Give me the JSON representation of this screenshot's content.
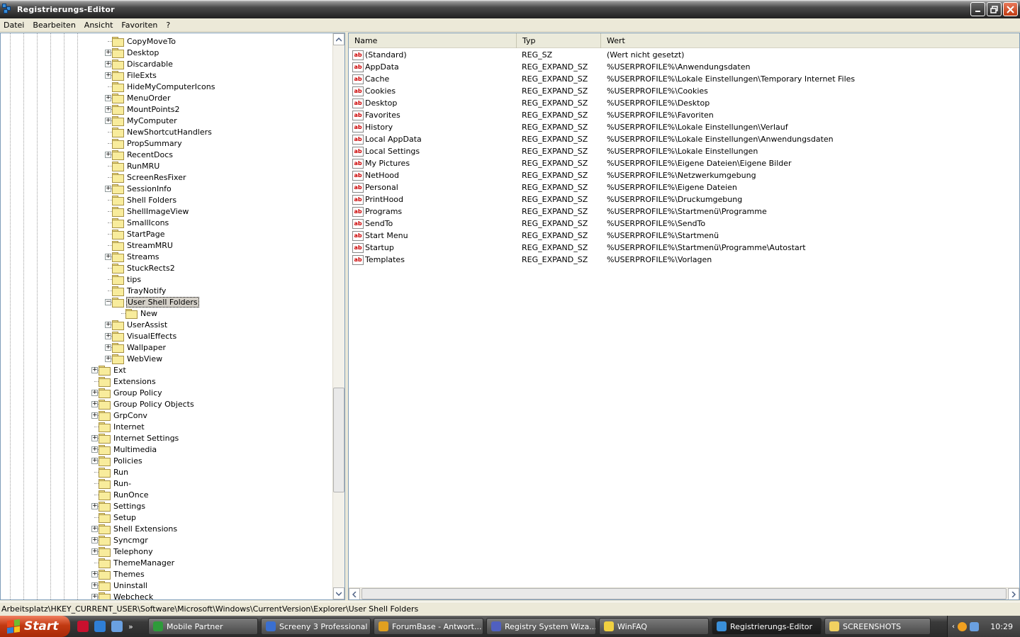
{
  "window": {
    "title": "Registrierungs-Editor"
  },
  "menu": [
    "Datei",
    "Bearbeiten",
    "Ansicht",
    "Favoriten",
    "?"
  ],
  "tree": {
    "items": [
      {
        "label": "CopyMoveTo",
        "level": 1,
        "expand": false
      },
      {
        "label": "Desktop",
        "level": 1,
        "expand": true
      },
      {
        "label": "Discardable",
        "level": 1,
        "expand": true
      },
      {
        "label": "FileExts",
        "level": 1,
        "expand": true
      },
      {
        "label": "HideMyComputerIcons",
        "level": 1,
        "expand": false
      },
      {
        "label": "MenuOrder",
        "level": 1,
        "expand": true
      },
      {
        "label": "MountPoints2",
        "level": 1,
        "expand": true
      },
      {
        "label": "MyComputer",
        "level": 1,
        "expand": true
      },
      {
        "label": "NewShortcutHandlers",
        "level": 1,
        "expand": false
      },
      {
        "label": "PropSummary",
        "level": 1,
        "expand": false
      },
      {
        "label": "RecentDocs",
        "level": 1,
        "expand": true
      },
      {
        "label": "RunMRU",
        "level": 1,
        "expand": false
      },
      {
        "label": "ScreenResFixer",
        "level": 1,
        "expand": false
      },
      {
        "label": "SessionInfo",
        "level": 1,
        "expand": true
      },
      {
        "label": "Shell Folders",
        "level": 1,
        "expand": false
      },
      {
        "label": "ShellImageView",
        "level": 1,
        "expand": false
      },
      {
        "label": "SmallIcons",
        "level": 1,
        "expand": false
      },
      {
        "label": "StartPage",
        "level": 1,
        "expand": false
      },
      {
        "label": "StreamMRU",
        "level": 1,
        "expand": false
      },
      {
        "label": "Streams",
        "level": 1,
        "expand": true
      },
      {
        "label": "StuckRects2",
        "level": 1,
        "expand": false
      },
      {
        "label": "tips",
        "level": 1,
        "expand": false
      },
      {
        "label": "TrayNotify",
        "level": 1,
        "expand": false
      },
      {
        "label": "User Shell Folders",
        "level": 1,
        "expand": "minus",
        "selected": true
      },
      {
        "label": "New",
        "level": 2,
        "expand": false
      },
      {
        "label": "UserAssist",
        "level": 1,
        "expand": true
      },
      {
        "label": "VisualEffects",
        "level": 1,
        "expand": true
      },
      {
        "label": "Wallpaper",
        "level": 1,
        "expand": true
      },
      {
        "label": "WebView",
        "level": 1,
        "expand": true
      },
      {
        "label": "Ext",
        "level": 0,
        "expand": true
      },
      {
        "label": "Extensions",
        "level": 0,
        "expand": false
      },
      {
        "label": "Group Policy",
        "level": 0,
        "expand": true
      },
      {
        "label": "Group Policy Objects",
        "level": 0,
        "expand": true
      },
      {
        "label": "GrpConv",
        "level": 0,
        "expand": true
      },
      {
        "label": "Internet",
        "level": 0,
        "expand": false
      },
      {
        "label": "Internet Settings",
        "level": 0,
        "expand": true
      },
      {
        "label": "Multimedia",
        "level": 0,
        "expand": true
      },
      {
        "label": "Policies",
        "level": 0,
        "expand": true
      },
      {
        "label": "Run",
        "level": 0,
        "expand": false
      },
      {
        "label": "Run-",
        "level": 0,
        "expand": false
      },
      {
        "label": "RunOnce",
        "level": 0,
        "expand": false
      },
      {
        "label": "Settings",
        "level": 0,
        "expand": true
      },
      {
        "label": "Setup",
        "level": 0,
        "expand": false
      },
      {
        "label": "Shell Extensions",
        "level": 0,
        "expand": true
      },
      {
        "label": "Syncmgr",
        "level": 0,
        "expand": true
      },
      {
        "label": "Telephony",
        "level": 0,
        "expand": true
      },
      {
        "label": "ThemeManager",
        "level": 0,
        "expand": false
      },
      {
        "label": "Themes",
        "level": 0,
        "expand": true
      },
      {
        "label": "Uninstall",
        "level": 0,
        "expand": true
      },
      {
        "label": "Webcheck",
        "level": 0,
        "expand": true
      }
    ]
  },
  "list": {
    "columns": [
      "Name",
      "Typ",
      "Wert"
    ],
    "rows": [
      {
        "name": "(Standard)",
        "type": "REG_SZ",
        "value": "(Wert nicht gesetzt)"
      },
      {
        "name": "AppData",
        "type": "REG_EXPAND_SZ",
        "value": "%USERPROFILE%\\Anwendungsdaten"
      },
      {
        "name": "Cache",
        "type": "REG_EXPAND_SZ",
        "value": "%USERPROFILE%\\Lokale Einstellungen\\Temporary Internet Files"
      },
      {
        "name": "Cookies",
        "type": "REG_EXPAND_SZ",
        "value": "%USERPROFILE%\\Cookies"
      },
      {
        "name": "Desktop",
        "type": "REG_EXPAND_SZ",
        "value": "%USERPROFILE%\\Desktop"
      },
      {
        "name": "Favorites",
        "type": "REG_EXPAND_SZ",
        "value": "%USERPROFILE%\\Favoriten"
      },
      {
        "name": "History",
        "type": "REG_EXPAND_SZ",
        "value": "%USERPROFILE%\\Lokale Einstellungen\\Verlauf"
      },
      {
        "name": "Local AppData",
        "type": "REG_EXPAND_SZ",
        "value": "%USERPROFILE%\\Lokale Einstellungen\\Anwendungsdaten"
      },
      {
        "name": "Local Settings",
        "type": "REG_EXPAND_SZ",
        "value": "%USERPROFILE%\\Lokale Einstellungen"
      },
      {
        "name": "My Pictures",
        "type": "REG_EXPAND_SZ",
        "value": "%USERPROFILE%\\Eigene Dateien\\Eigene Bilder"
      },
      {
        "name": "NetHood",
        "type": "REG_EXPAND_SZ",
        "value": "%USERPROFILE%\\Netzwerkumgebung"
      },
      {
        "name": "Personal",
        "type": "REG_EXPAND_SZ",
        "value": "%USERPROFILE%\\Eigene Dateien"
      },
      {
        "name": "PrintHood",
        "type": "REG_EXPAND_SZ",
        "value": "%USERPROFILE%\\Druckumgebung"
      },
      {
        "name": "Programs",
        "type": "REG_EXPAND_SZ",
        "value": "%USERPROFILE%\\Startmenü\\Programme"
      },
      {
        "name": "SendTo",
        "type": "REG_EXPAND_SZ",
        "value": "%USERPROFILE%\\SendTo"
      },
      {
        "name": "Start Menu",
        "type": "REG_EXPAND_SZ",
        "value": "%USERPROFILE%\\Startmenü"
      },
      {
        "name": "Startup",
        "type": "REG_EXPAND_SZ",
        "value": "%USERPROFILE%\\Startmenü\\Programme\\Autostart"
      },
      {
        "name": "Templates",
        "type": "REG_EXPAND_SZ",
        "value": "%USERPROFILE%\\Vorlagen"
      }
    ]
  },
  "statusbar": {
    "path": "Arbeitsplatz\\HKEY_CURRENT_USER\\Software\\Microsoft\\Windows\\CurrentVersion\\Explorer\\User Shell Folders"
  },
  "taskbar": {
    "start_label": "Start",
    "tasks": [
      {
        "label": "Mobile Partner",
        "icon_color": "#2e9b3a",
        "active": false
      },
      {
        "label": "Screeny 3 Professional",
        "icon_color": "#3a6fd0",
        "active": false
      },
      {
        "label": "ForumBase - Antwort...",
        "icon_color": "#e0a020",
        "active": false
      },
      {
        "label": "Registry System Wiza...",
        "icon_color": "#5060c0",
        "active": false
      },
      {
        "label": "WinFAQ",
        "icon_color": "#f0d040",
        "active": false
      },
      {
        "label": "Registrierungs-Editor",
        "icon_color": "#3a8fd8",
        "active": true
      },
      {
        "label": "SCREENSHOTS",
        "icon_color": "#f0d060",
        "active": false
      }
    ],
    "clock": "10:29"
  },
  "icons": {
    "value_icon": "ab"
  }
}
